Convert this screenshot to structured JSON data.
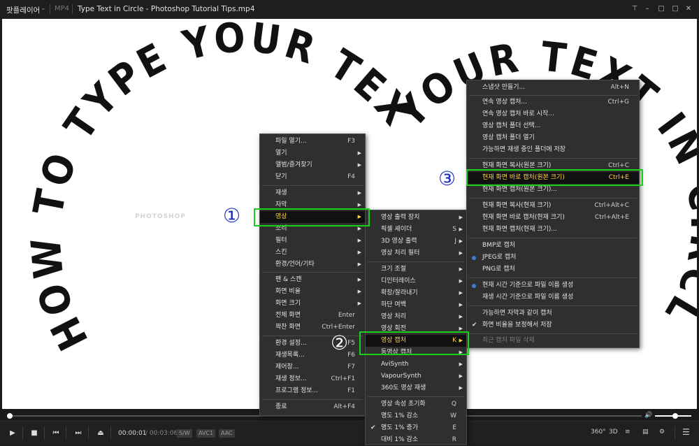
{
  "titlebar": {
    "app_name": "팟플레이어",
    "format": "MP4",
    "file_title": "Type Text in Circle - Photoshop Tutorial Tips.mp4"
  },
  "video": {
    "circle_text_left": "HOW TO TYPE YOUR TEXT IN CIRCLE. ",
    "circle_text_right": "YOUR TEXT IN CIRCLE ",
    "watermark": "PHOTOSHOP"
  },
  "controls": {
    "current_time": "00:00:01",
    "total_time": "/ 00:03:06",
    "tags": [
      "S/W",
      "AVC1",
      "AAC"
    ],
    "right_icons": [
      "360°",
      "3D"
    ],
    "seek_progress": 0.004,
    "volume_level": 0.55
  },
  "menu_main": {
    "items": [
      {
        "label": "파일 열기...",
        "shortcut": "F3"
      },
      {
        "label": "열기",
        "arrow": true
      },
      {
        "label": "앨범/즐겨찾기",
        "arrow": true
      },
      {
        "label": "닫기",
        "shortcut": "F4"
      },
      {
        "label": "재생",
        "arrow": true
      },
      {
        "label": "자막",
        "arrow": true
      },
      {
        "label": "영상",
        "arrow": true,
        "highlight": true
      },
      {
        "label": "소리",
        "arrow": true
      },
      {
        "label": "필터",
        "arrow": true
      },
      {
        "label": "스킨",
        "arrow": true
      },
      {
        "label": "환경/언어/기타",
        "arrow": true
      },
      {
        "label": "팬 & 스캔",
        "arrow": true
      },
      {
        "label": "화면 비율",
        "arrow": true
      },
      {
        "label": "화면 크기",
        "arrow": true
      },
      {
        "label": "전체 화면",
        "shortcut": "Enter"
      },
      {
        "label": "꽉찬 화면",
        "shortcut": "Ctrl+Enter"
      },
      {
        "label": "환경 설정...",
        "shortcut": "F5"
      },
      {
        "label": "재생목록...",
        "shortcut": "F6"
      },
      {
        "label": "제어창...",
        "shortcut": "F7"
      },
      {
        "label": "재생 정보...",
        "shortcut": "Ctrl+F1"
      },
      {
        "label": "프로그램 정보...",
        "shortcut": "F1"
      },
      {
        "label": "종료",
        "shortcut": "Alt+F4"
      }
    ]
  },
  "menu_video": {
    "items": [
      {
        "label": "영상 출력 장치",
        "arrow": true
      },
      {
        "label": "픽셀 셰이더",
        "shortcut": "S",
        "arrow": true
      },
      {
        "label": "3D 영상 출력",
        "shortcut": "J",
        "arrow": true
      },
      {
        "label": "영상 처리 필터",
        "arrow": true
      },
      {
        "label": "크기 조절",
        "arrow": true
      },
      {
        "label": "디인터레이스",
        "arrow": true
      },
      {
        "label": "확장/잘라내기",
        "arrow": true
      },
      {
        "label": "하단 여백",
        "arrow": true
      },
      {
        "label": "영상 처리",
        "arrow": true
      },
      {
        "label": "영상 회전",
        "arrow": true
      },
      {
        "label": "영상 캡처",
        "shortcut": "K",
        "arrow": true,
        "highlight": true
      },
      {
        "label": "동영상 캡처",
        "arrow": true
      },
      {
        "label": "AviSynth",
        "arrow": true
      },
      {
        "label": "VapourSynth",
        "arrow": true
      },
      {
        "label": "360도 영상 재생",
        "arrow": true
      },
      {
        "label": "영상 속성 초기화",
        "shortcut": "Q"
      },
      {
        "label": "명도 1% 감소",
        "shortcut": "W"
      },
      {
        "label": "명도 1% 증가",
        "shortcut": "E",
        "checked": true
      },
      {
        "label": "대비 1% 감소",
        "shortcut": "R"
      }
    ]
  },
  "menu_capture": {
    "items": [
      {
        "label": "스냅샷 만들기...",
        "shortcut": "Alt+N"
      },
      {
        "label": "연속 영상 캡처...",
        "shortcut": "Ctrl+G"
      },
      {
        "label": "연속 영상 캡처 바로 시작..."
      },
      {
        "label": "영상 캡처 폴더 선택..."
      },
      {
        "label": "영상 캡처 폴더 열기"
      },
      {
        "label": "가능하면 재생 중인 폴더에 저장"
      },
      {
        "label": "현재 화면 복사(원본 크기)",
        "shortcut": "Ctrl+C"
      },
      {
        "label": "현재 화면 바로 캡처(원본 크기)",
        "shortcut": "Ctrl+E",
        "highlight": true
      },
      {
        "label": "현재 화면 캡처(원본 크기)..."
      },
      {
        "label": "현재 화면 복사(현재 크기)",
        "shortcut": "Ctrl+Alt+C"
      },
      {
        "label": "현재 화면 바로 캡처(현재 크기)",
        "shortcut": "Ctrl+Alt+E"
      },
      {
        "label": "현재 화면 캡처(현재 크기)..."
      },
      {
        "label": "BMP로 캡처"
      },
      {
        "label": "JPEG로 캡처",
        "radio": true
      },
      {
        "label": "PNG로 캡처"
      },
      {
        "label": "현재 시간 기준으로 파일 이름 생성",
        "radio": true
      },
      {
        "label": "재생 시간 기준으로 파일 이름 생성"
      },
      {
        "label": "가능하면 자막과 같이 캡처"
      },
      {
        "label": "화면 비율을 보정해서 저장",
        "checked": true
      },
      {
        "label": "최근 캡처 파일 삭제",
        "disabled": true
      }
    ]
  },
  "annotations": {
    "step1": "①",
    "step2": "②",
    "step3": "③"
  },
  "colors": {
    "menu_bg": "#2f2f2f",
    "highlight_text": "#ffd24a",
    "annotation_box": "#19d019",
    "step1_color": "#1a2fbf",
    "step3_color": "#1a2fbf"
  }
}
